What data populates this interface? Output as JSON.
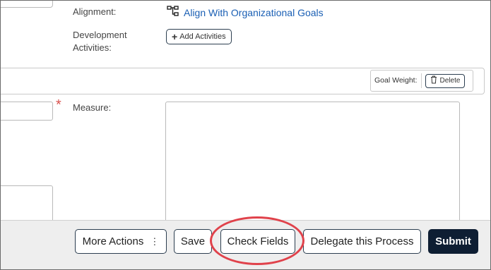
{
  "alignment": {
    "label": "Alignment:",
    "link_text": "Align With Organizational Goals",
    "link_icon": "hierarchy-icon"
  },
  "development": {
    "label_line1": "Development",
    "label_line2": "Activities:",
    "add_button_label": "Add Activities"
  },
  "goal": {
    "weight_label": "Goal Weight:",
    "delete_label": "Delete"
  },
  "measure": {
    "label": "Measure:",
    "required_marker": "*",
    "value": ""
  },
  "footer": {
    "more_actions_label": "More Actions",
    "more_actions_icon": "⋮",
    "save_label": "Save",
    "check_fields_label": "Check Fields",
    "delegate_label": "Delegate this Process",
    "submit_label": "Submit"
  },
  "colors": {
    "link": "#1a5fb4",
    "primary_button": "#0e1e33",
    "required": "#d9534f",
    "highlight": "#e0424b",
    "footer_bg": "#eeeeee"
  }
}
